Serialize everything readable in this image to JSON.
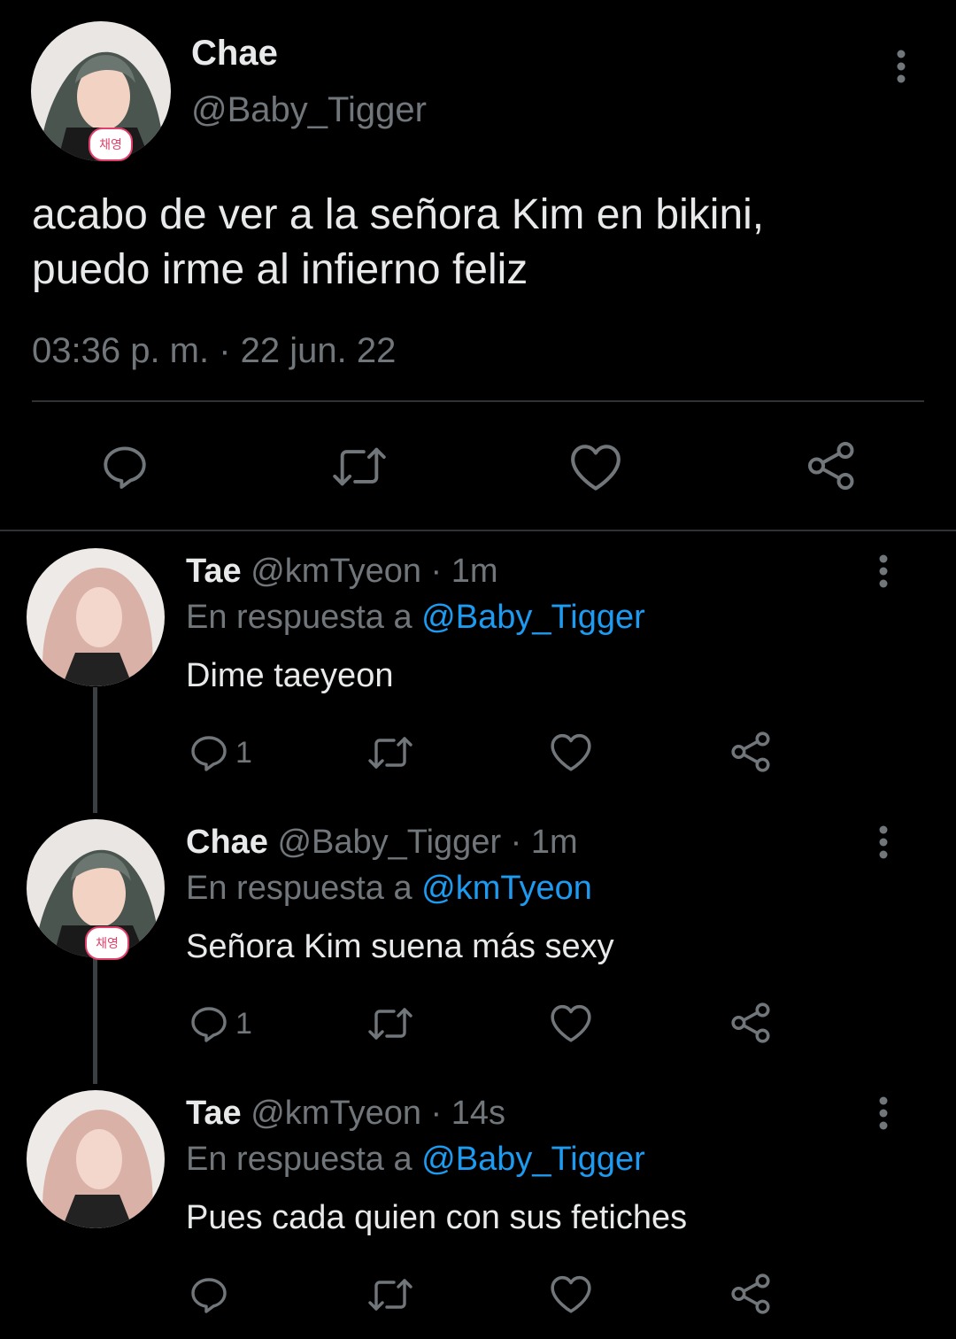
{
  "main_tweet": {
    "display_name": "Chae",
    "handle": "@Baby_Tigger",
    "text_line1": "acabo de ver a la señora Kim en bikini,",
    "text_line2": "puedo irme al infierno feliz",
    "timestamp": "03:36 p. m. · 22 jun. 22",
    "avatar_badge": "채영"
  },
  "replies": [
    {
      "display_name": "Tae",
      "handle": "@kmTyeon",
      "time": "· 1m",
      "reply_prefix": "En respuesta a",
      "reply_to": "@Baby_Tigger",
      "text": "Dime taeyeon",
      "reply_count": "1"
    },
    {
      "display_name": "Chae",
      "handle": "@Baby_Tigger",
      "time": "· 1m",
      "reply_prefix": "En respuesta a",
      "reply_to": "@kmTyeon",
      "text": "Señora Kim suena más sexy",
      "reply_count": "1",
      "avatar_badge": "채영"
    },
    {
      "display_name": "Tae",
      "handle": "@kmTyeon",
      "time": "· 14s",
      "reply_prefix": "En respuesta a",
      "reply_to": "@Baby_Tigger",
      "text": "Pues cada quien con sus fetiches",
      "reply_count": ""
    }
  ],
  "icons": [
    "more-vertical-icon",
    "reply-icon",
    "retweet-icon",
    "like-icon",
    "share-icon"
  ],
  "colors": {
    "background": "#000000",
    "text": "#e7e9ea",
    "muted": "#71767b",
    "link": "#1d9bf0",
    "divider": "#2f3336"
  }
}
